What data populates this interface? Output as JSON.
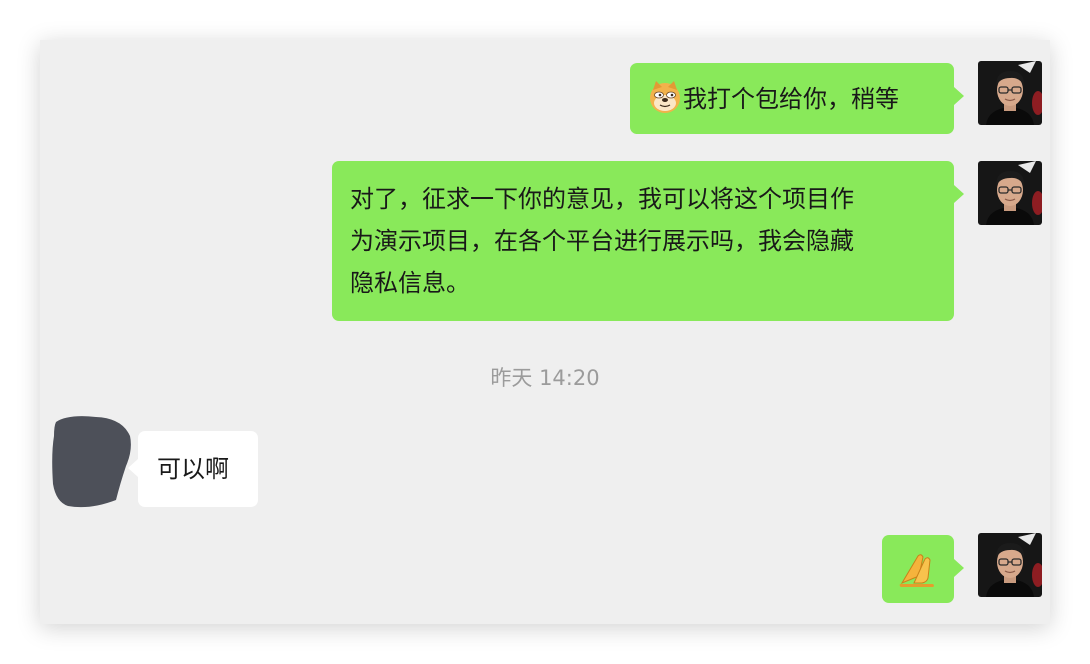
{
  "messages": [
    {
      "direction": "out",
      "emoji": "doge-emoji",
      "text": "我打个包给你，稍等"
    },
    {
      "direction": "out",
      "lines": [
        "对了，征求一下你的意见，我可以将这个项目作",
        "为演示项目，在各个平台进行展示吗，我会隐藏",
        "隐私信息。"
      ]
    },
    {
      "direction": "in",
      "text": "可以啊"
    },
    {
      "direction": "out",
      "emoji": "folded-hands-emoji"
    }
  ],
  "timestamp": "昨天 14:20",
  "colors": {
    "outgoing_bubble": "#89e95a",
    "incoming_bubble": "#ffffff",
    "background": "#efefef",
    "contact_avatar_redacted": "#4d5059"
  }
}
